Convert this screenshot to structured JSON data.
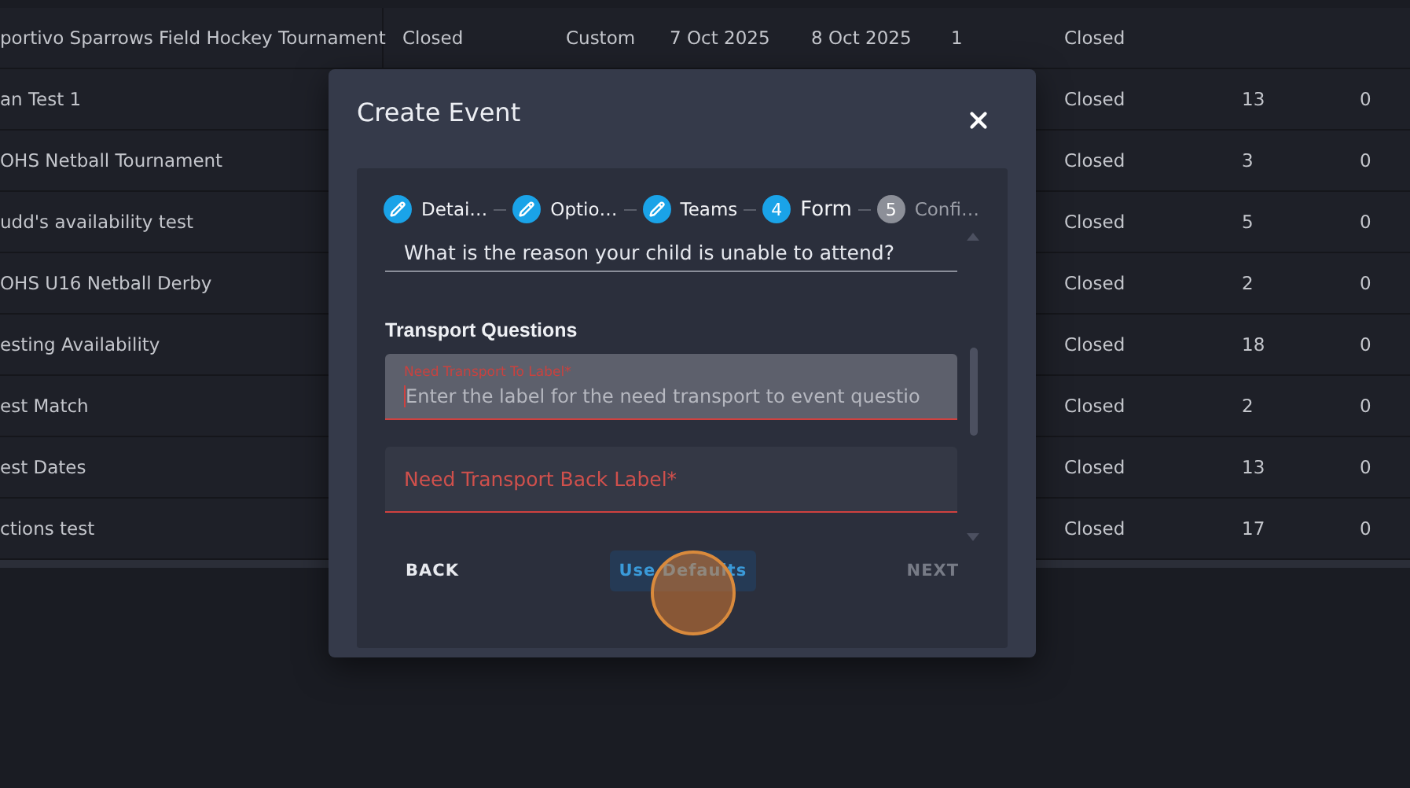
{
  "table": {
    "rows": [
      {
        "name": "portivo Sparrows Field Hockey Tournament",
        "status": "Closed",
        "type": "Custom",
        "start_date": "7 Oct 2025",
        "end_date": "8 Oct 2025",
        "column_6": "1",
        "status_2": "Closed"
      },
      {
        "name": "an Test 1",
        "status_2": "Closed",
        "column_8": "13",
        "column_9": "0"
      },
      {
        "name": "OHS Netball Tournament",
        "status_2": "Closed",
        "column_8": "3",
        "column_9": "0"
      },
      {
        "name": "udd's availability test",
        "status_2": "Closed",
        "column_8": "5",
        "column_9": "0"
      },
      {
        "name": "OHS U16 Netball Derby",
        "status_2": "Closed",
        "column_8": "2",
        "column_9": "0"
      },
      {
        "name": "esting Availability",
        "status_2": "Closed",
        "column_8": "18",
        "column_9": "0"
      },
      {
        "name": "est Match",
        "status_2": "Closed",
        "column_8": "2",
        "column_9": "0"
      },
      {
        "name": "est Dates",
        "status_2": "Closed",
        "column_8": "13",
        "column_9": "0"
      },
      {
        "name": "ctions test",
        "status_2": "Closed",
        "column_8": "17",
        "column_9": "0"
      }
    ]
  },
  "dialog": {
    "title": "Create Event",
    "steps": [
      {
        "kind": "done",
        "label": "Detai…"
      },
      {
        "kind": "done",
        "label": "Optio…"
      },
      {
        "kind": "done",
        "label": "Teams"
      },
      {
        "kind": "active",
        "number": "4",
        "label": "Form"
      },
      {
        "kind": "pending",
        "number": "5",
        "label": "Confi…"
      }
    ],
    "reason_field": {
      "value": "What is the reason your child is unable to attend?"
    },
    "section_title": "Transport Questions",
    "transport_fields": [
      {
        "label": "Need Transport To Label*",
        "placeholder": "Enter the label for the need transport to event questio",
        "focused": true,
        "error": true
      },
      {
        "label": "Need Transport Back Label*",
        "focused": false,
        "error": true
      }
    ],
    "buttons": [
      {
        "kind": "text",
        "label": "BACK",
        "disabled": false
      },
      {
        "kind": "tonal",
        "label": "Use Defaults",
        "disabled": false
      },
      {
        "kind": "text",
        "label": "NEXT",
        "disabled": true
      }
    ]
  }
}
